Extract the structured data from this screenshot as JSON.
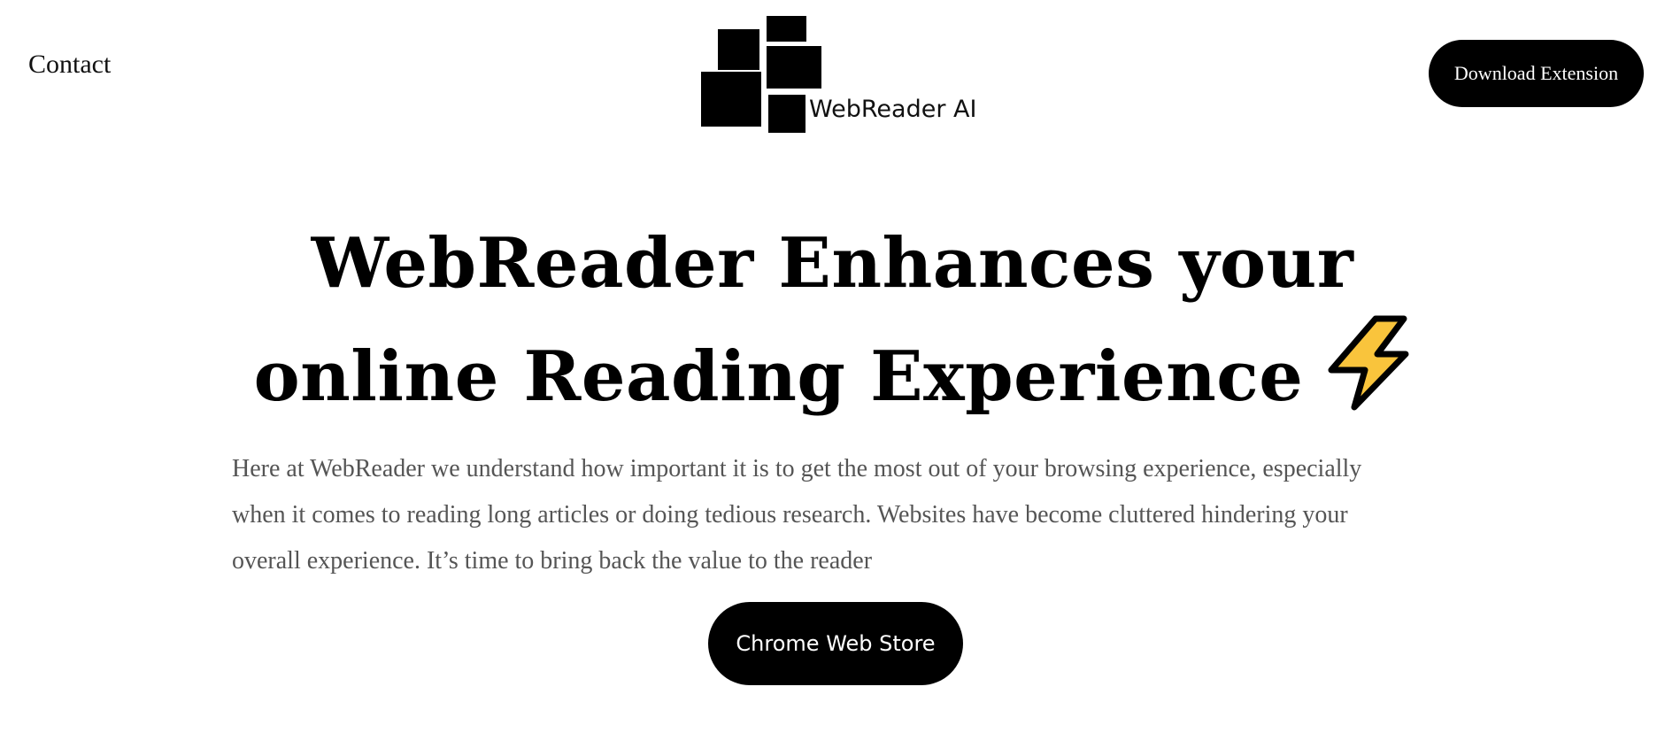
{
  "nav": {
    "contact_label": "Contact",
    "download_label": "Download Extension"
  },
  "logo": {
    "text": "WebReader AI",
    "icon": "stacked-blocks-logo"
  },
  "hero": {
    "title_line1": "WebReader Enhances your",
    "title_line2": "online Reading Experience",
    "title_icon": "lightning-bolt-emoji",
    "description": "Here at WebReader we understand how important it is to get the most out of your browsing experience, especially when it comes to reading long articles or doing tedious research. Websites have become cluttered hindering your overall experience.  It’s time to bring back the value to the reader",
    "cta_label": "Chrome Web Store"
  },
  "colors": {
    "background": "#ffffff",
    "text": "#000000",
    "muted_text": "#555555",
    "button_bg": "#000000",
    "button_text": "#ffffff",
    "bolt_fill": "#f9c43c",
    "bolt_stroke": "#000000"
  }
}
